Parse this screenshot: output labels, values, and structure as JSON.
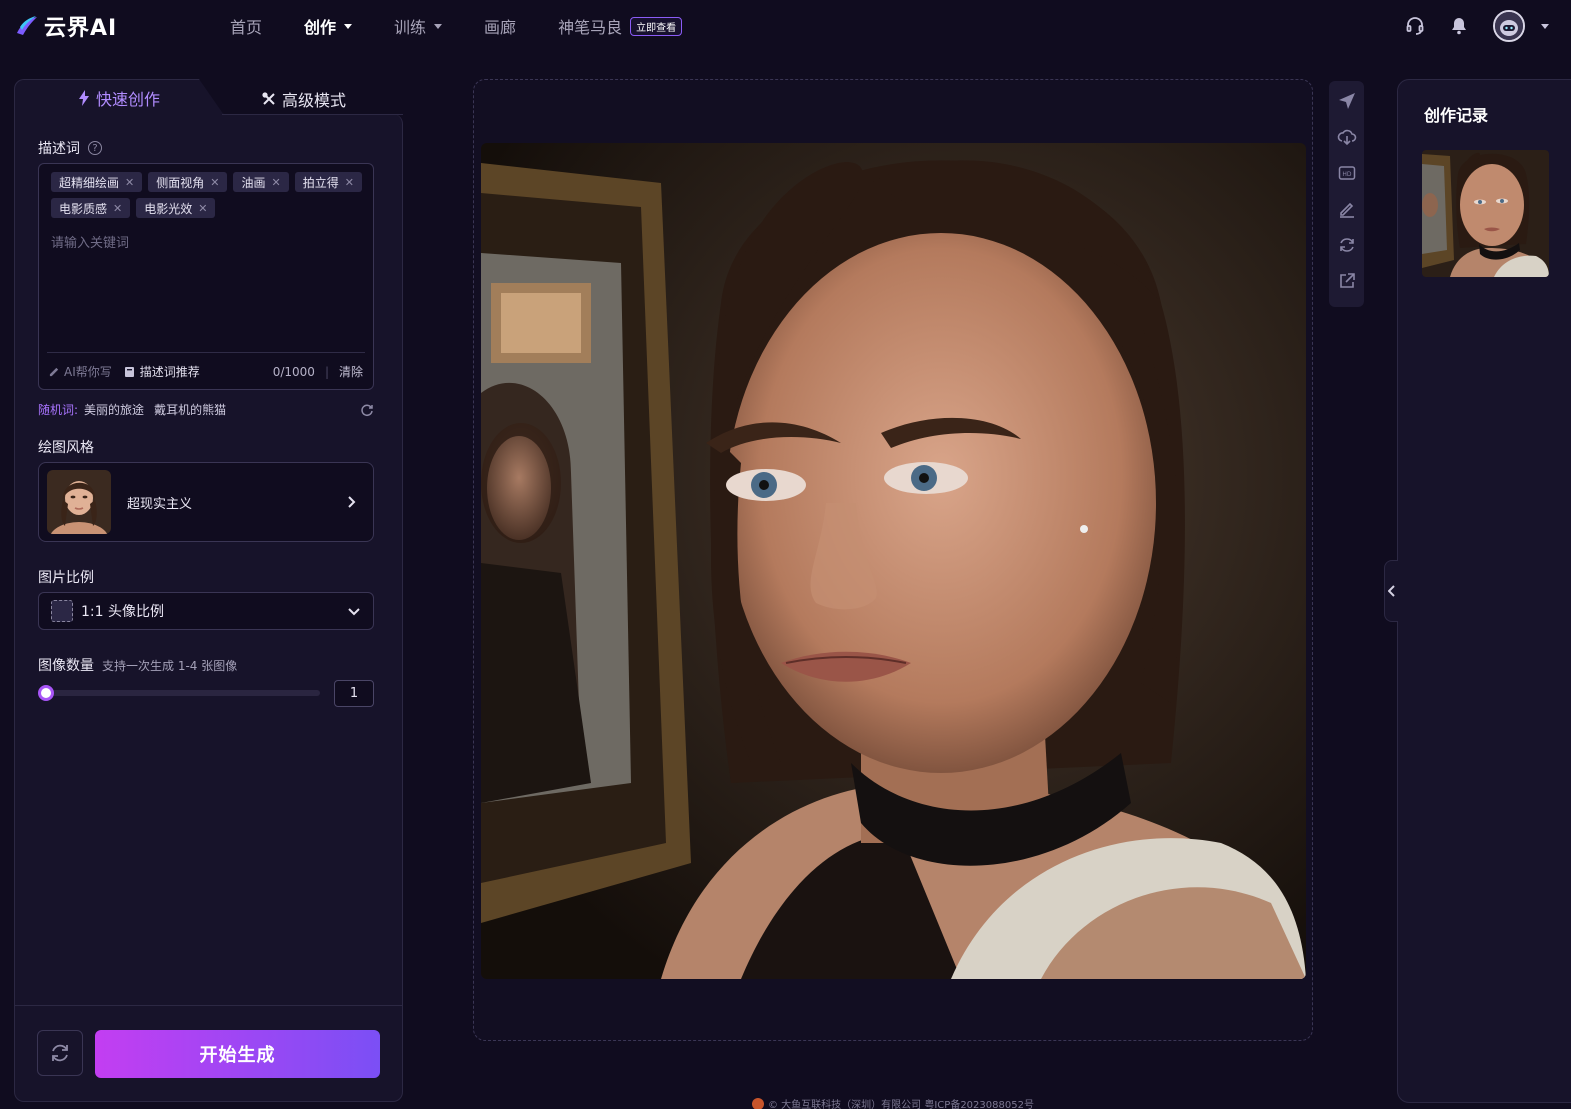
{
  "app": {
    "logo_text": "云界AI"
  },
  "nav": {
    "items": [
      {
        "label": "首页"
      },
      {
        "label": "创作"
      },
      {
        "label": "训练"
      },
      {
        "label": "画廊"
      },
      {
        "label": "神笔马良"
      }
    ],
    "badge": "立即查看"
  },
  "tabs": {
    "quick": "快速创作",
    "advanced": "高级模式"
  },
  "prompt": {
    "label": "描述词",
    "help": "?",
    "tags": [
      "超精细绘画",
      "侧面视角",
      "油画",
      "拍立得",
      "电影质感",
      "电影光效"
    ],
    "placeholder": "请输入关键词",
    "ai_write": "AI帮你写",
    "recommend": "描述词推荐",
    "count": "0/1000",
    "clear": "清除"
  },
  "random": {
    "label": "随机词:",
    "words": [
      "美丽的旅途",
      "戴耳机的熊猫"
    ]
  },
  "style": {
    "label": "绘图风格",
    "name": "超现实主义"
  },
  "ratio": {
    "label": "图片比例",
    "value": "1:1 头像比例"
  },
  "image_count": {
    "label": "图像数量",
    "note": "支持一次生成 1-4 张图像",
    "value": "1",
    "min": 1,
    "max": 4
  },
  "actions": {
    "generate": "开始生成"
  },
  "history": {
    "title": "创作记录"
  },
  "footer": {
    "text": "© 大鱼互联科技（深圳）有限公司 粤ICP备2023088052号"
  },
  "colors": {
    "accent": "#a855f7",
    "background": "#100c1f",
    "panel": "#17132a"
  }
}
